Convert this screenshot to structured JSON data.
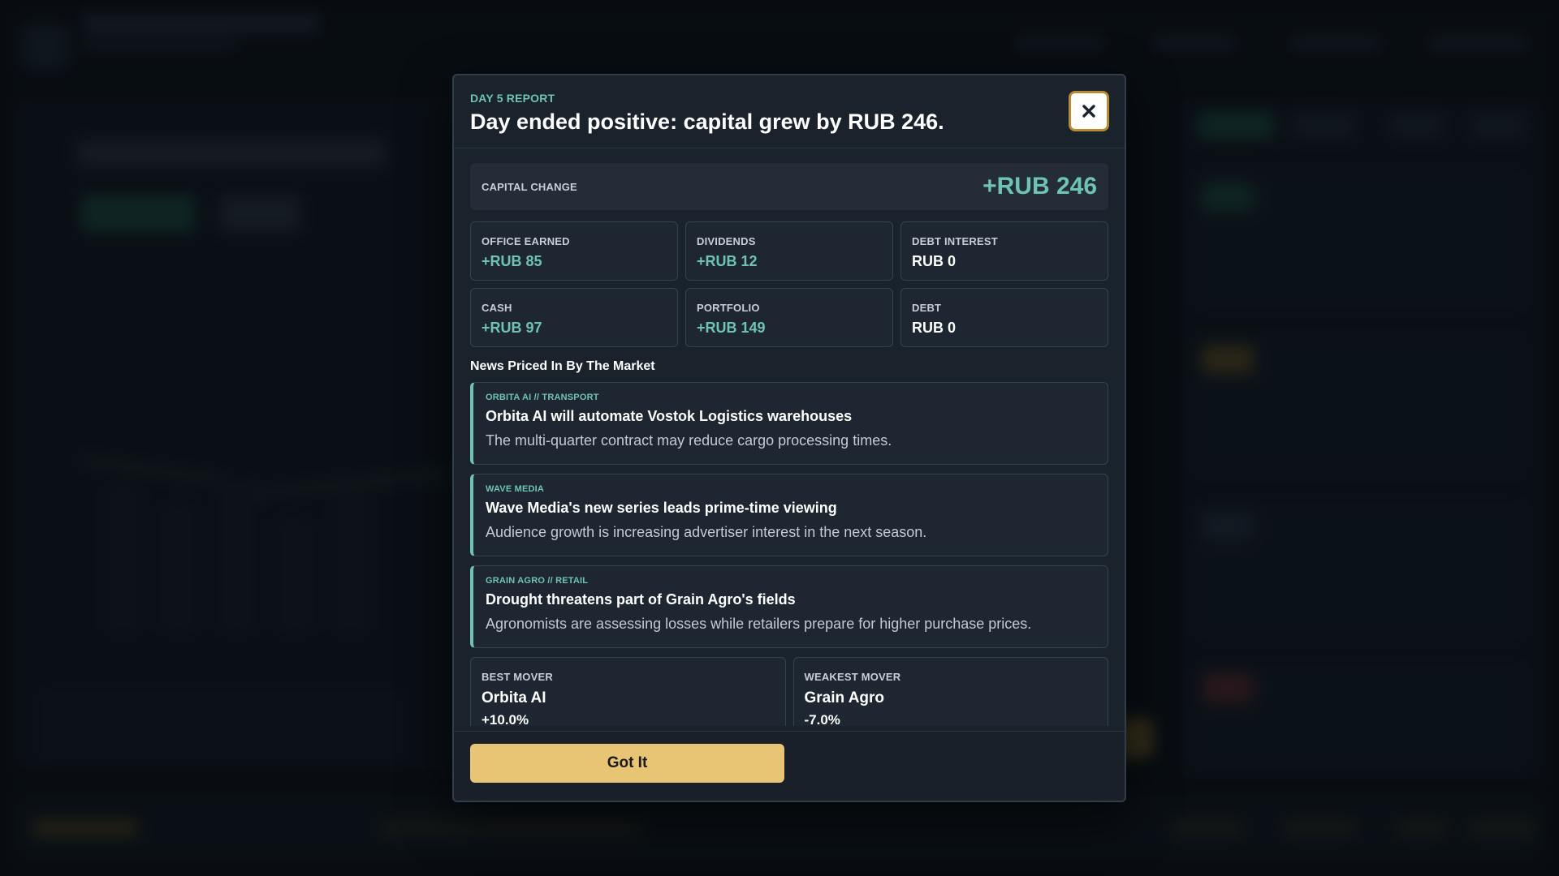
{
  "report": {
    "eyebrow": "DAY 5 REPORT",
    "title": "Day ended positive: capital grew by RUB 246.",
    "close_icon": "close-icon"
  },
  "capital": {
    "label": "CAPITAL CHANGE",
    "value": "+RUB 246"
  },
  "stats": [
    {
      "label": "OFFICE EARNED",
      "value": "+RUB 85",
      "tone": "positive"
    },
    {
      "label": "DIVIDENDS",
      "value": "+RUB 12",
      "tone": "positive"
    },
    {
      "label": "DEBT INTEREST",
      "value": "RUB 0",
      "tone": "neutral"
    },
    {
      "label": "CASH",
      "value": "+RUB 97",
      "tone": "positive"
    },
    {
      "label": "PORTFOLIO",
      "value": "+RUB 149",
      "tone": "positive"
    },
    {
      "label": "DEBT",
      "value": "RUB 0",
      "tone": "neutral"
    }
  ],
  "news": {
    "heading": "News Priced In By The Market",
    "items": [
      {
        "tag": "ORBITA AI // TRANSPORT",
        "headline": "Orbita AI will automate Vostok Logistics warehouses",
        "description": "The multi-quarter contract may reduce cargo processing times."
      },
      {
        "tag": "WAVE MEDIA",
        "headline": "Wave Media's new series leads prime-time viewing",
        "description": "Audience growth is increasing advertiser interest in the next season."
      },
      {
        "tag": "GRAIN AGRO // RETAIL",
        "headline": "Drought threatens part of Grain Agro's fields",
        "description": "Agronomists are assessing losses while retailers prepare for higher purchase prices."
      }
    ]
  },
  "movers": {
    "best": {
      "label": "BEST MOVER",
      "name": "Orbita AI",
      "change": "+10.0%"
    },
    "weakest": {
      "label": "WEAKEST MOVER",
      "name": "Grain Agro",
      "change": "-7.0%"
    }
  },
  "footer": {
    "button_label": "Got It"
  },
  "colors": {
    "accent_positive": "#6fc3b2",
    "button": "#e8c574",
    "close_border": "#b88a33",
    "modal_bg": "#1a222c"
  }
}
